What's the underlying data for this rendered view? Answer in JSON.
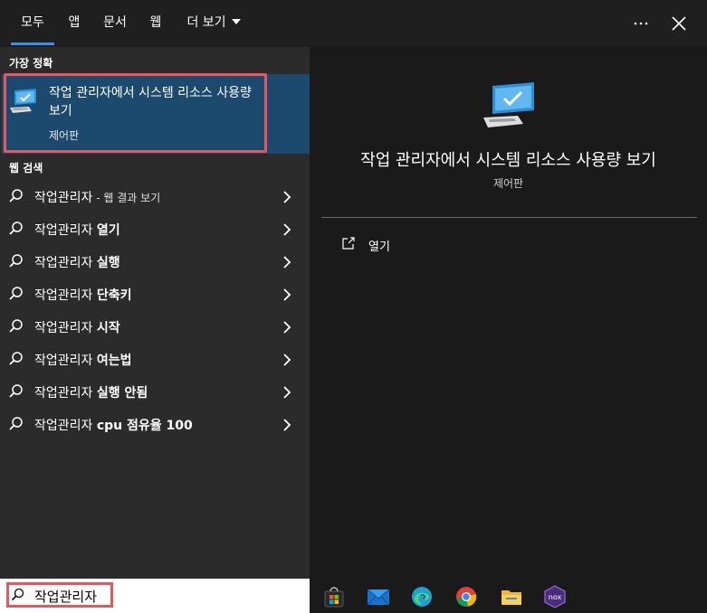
{
  "tabs": [
    {
      "label": "모두",
      "active": true
    },
    {
      "label": "앱",
      "active": false
    },
    {
      "label": "문서",
      "active": false
    },
    {
      "label": "웹",
      "active": false
    },
    {
      "label": "더 보기",
      "active": false
    }
  ],
  "topbar_icons": [
    "more-options-icon",
    "close-icon"
  ],
  "best_match": {
    "section_label": "가장 정확",
    "title": "작업 관리자에서 시스템 리소스 사용량 보기",
    "subtitle": "제어판",
    "icon": "monitor-check-icon"
  },
  "web_search": {
    "section_label": "웹 검색",
    "items": [
      {
        "base": "작업관리자",
        "bold": "",
        "suffix": " - 웹 결과 보기"
      },
      {
        "base": "작업관리자 ",
        "bold": "열기",
        "suffix": ""
      },
      {
        "base": "작업관리자 ",
        "bold": "실행",
        "suffix": ""
      },
      {
        "base": "작업관리자 ",
        "bold": "단축키",
        "suffix": ""
      },
      {
        "base": "작업관리자 ",
        "bold": "시작",
        "suffix": ""
      },
      {
        "base": "작업관리자 ",
        "bold": "여는법",
        "suffix": ""
      },
      {
        "base": "작업관리자 ",
        "bold": "실행 안됨",
        "suffix": ""
      },
      {
        "base": "작업관리자 ",
        "bold": "cpu 점유율 100",
        "suffix": ""
      }
    ]
  },
  "preview": {
    "title": "작업 관리자에서 시스템 리소스 사용량 보기",
    "subtitle": "제어판",
    "actions": [
      {
        "label": "열기",
        "icon": "open-external-icon"
      }
    ]
  },
  "search": {
    "value": "작업관리자",
    "icon": "search-icon"
  },
  "taskbar": [
    "store-icon",
    "mail-icon",
    "edge-icon",
    "chrome-icon",
    "file-explorer-icon",
    "nox-icon"
  ],
  "colors": {
    "accent": "#3b8eea",
    "highlight_outline": "#e8575b",
    "best_match_bg": "#1c4a6e",
    "left_bg": "#2b2b2b",
    "right_bg": "#1a1a1a"
  }
}
